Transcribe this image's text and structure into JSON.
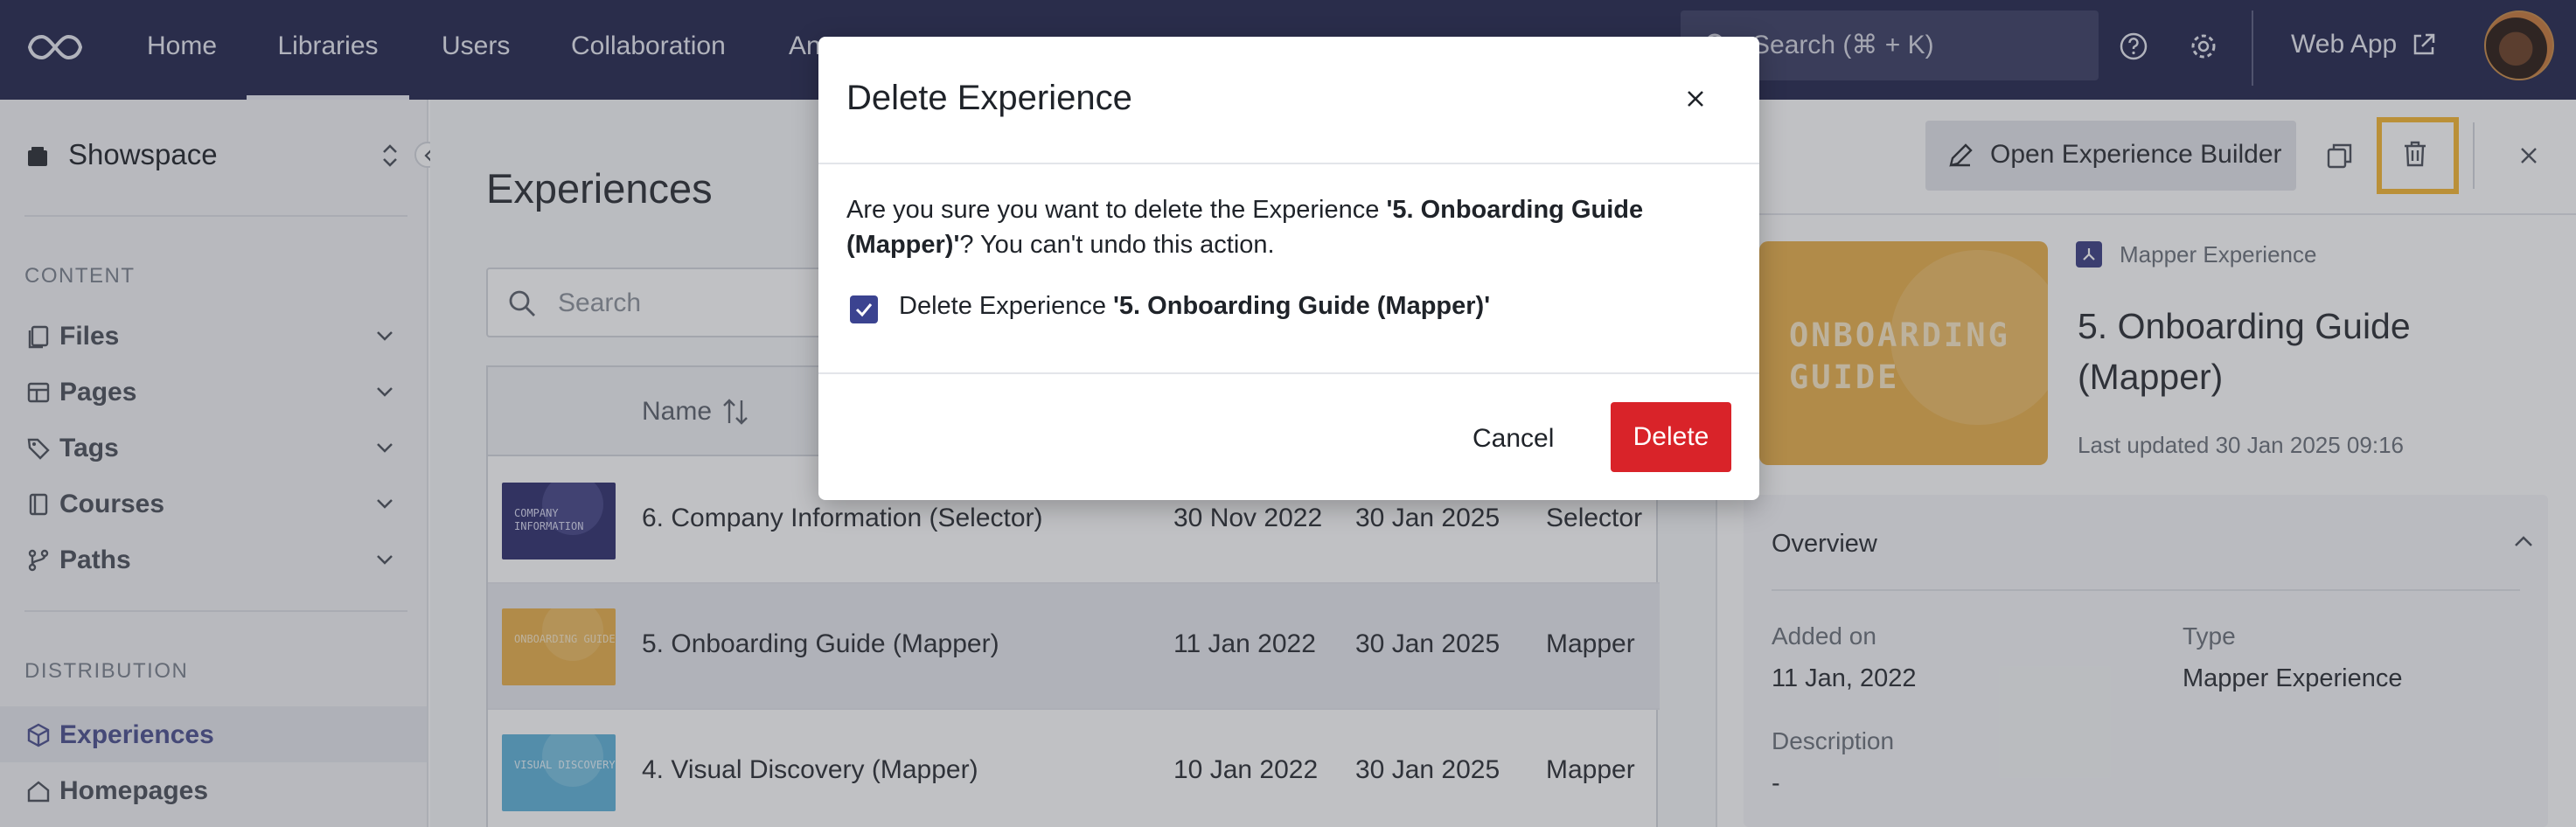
{
  "topnav": {
    "items": [
      "Home",
      "Libraries",
      "Users",
      "Collaboration",
      "An"
    ],
    "active": "Libraries",
    "search_placeholder": "Search (⌘ + K)",
    "web_app_label": "Web App"
  },
  "sidebar": {
    "workspace": "Showspace",
    "content_heading": "CONTENT",
    "content_items": [
      {
        "label": "Files",
        "icon": "files-icon"
      },
      {
        "label": "Pages",
        "icon": "pages-icon"
      },
      {
        "label": "Tags",
        "icon": "tag-icon"
      },
      {
        "label": "Courses",
        "icon": "book-icon"
      },
      {
        "label": "Paths",
        "icon": "paths-icon"
      }
    ],
    "distribution_heading": "DISTRIBUTION",
    "distribution_items": [
      {
        "label": "Experiences",
        "icon": "cube-icon",
        "active": true
      },
      {
        "label": "Homepages",
        "icon": "home-icon"
      }
    ]
  },
  "main": {
    "title": "Experiences",
    "search_placeholder": "Search",
    "table": {
      "name_header": "Name",
      "rows": [
        {
          "thumb_text": "COMPANY INFORMATION",
          "thumb_color": "#2f2f6e",
          "name": "6. Company Information (Selector)",
          "created": "30 Nov 2022",
          "updated": "30 Jan 2025",
          "type": "Selector"
        },
        {
          "thumb_text": "ONBOARDING GUIDE",
          "thumb_color": "#e9b04b",
          "name": "5. Onboarding Guide (Mapper)",
          "created": "11 Jan 2022",
          "updated": "30 Jan 2025",
          "type": "Mapper"
        },
        {
          "thumb_text": "VISUAL DISCOVERY",
          "thumb_color": "#5fb3d9",
          "name": "4. Visual Discovery (Mapper)",
          "created": "10 Jan 2022",
          "updated": "30 Jan 2025",
          "type": "Mapper"
        }
      ]
    }
  },
  "panel": {
    "open_builder_label": "Open Experience Builder",
    "type_label": "Mapper Experience",
    "thumb_text_line1": "ONBOARDING",
    "thumb_text_line2": "GUIDE",
    "title": "5. Onboarding Guide (Mapper)",
    "last_updated": "Last updated 30 Jan 2025 09:16",
    "overview_title": "Overview",
    "added_on_label": "Added on",
    "added_on_value": "11 Jan, 2022",
    "type_field_label": "Type",
    "type_field_value": "Mapper Experience",
    "description_label": "Description",
    "description_value": "-"
  },
  "modal": {
    "title": "Delete Experience",
    "message_prefix": "Are you sure you want to delete the Experience ",
    "message_name": "'5. Onboarding Guide (Mapper)'",
    "message_suffix": "? You can't undo this action.",
    "checkbox_prefix": "Delete Experience ",
    "checkbox_name": "'5. Onboarding Guide (Mapper)'",
    "checkbox_checked": true,
    "cancel_label": "Cancel",
    "delete_label": "Delete"
  },
  "colors": {
    "topbar": "#22254d",
    "accent": "#3b4390",
    "danger": "#d92329",
    "highlight": "#f7b731"
  }
}
